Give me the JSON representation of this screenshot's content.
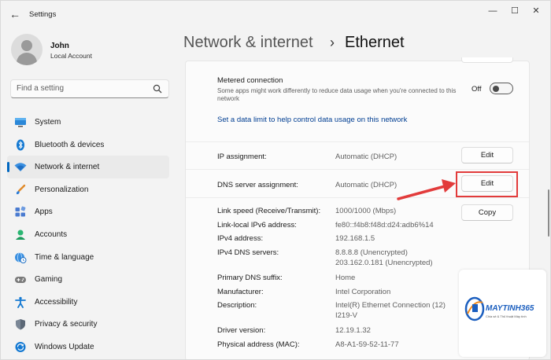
{
  "window": {
    "title": "Settings",
    "minimize": "—",
    "maximize": "☐",
    "close": "✕"
  },
  "profile": {
    "name": "John",
    "account": "Local Account"
  },
  "search": {
    "placeholder": "Find a setting"
  },
  "nav": {
    "items": [
      {
        "label": "System",
        "icon": "monitor-icon"
      },
      {
        "label": "Bluetooth & devices",
        "icon": "bluetooth-icon"
      },
      {
        "label": "Network & internet",
        "icon": "wifi-icon",
        "active": true
      },
      {
        "label": "Personalization",
        "icon": "brush-icon"
      },
      {
        "label": "Apps",
        "icon": "apps-icon"
      },
      {
        "label": "Accounts",
        "icon": "person-icon"
      },
      {
        "label": "Time & language",
        "icon": "globe-clock-icon"
      },
      {
        "label": "Gaming",
        "icon": "gamepad-icon"
      },
      {
        "label": "Accessibility",
        "icon": "accessibility-icon"
      },
      {
        "label": "Privacy & security",
        "icon": "shield-icon"
      },
      {
        "label": "Windows Update",
        "icon": "update-icon"
      }
    ]
  },
  "header": {
    "parent": "Network & internet",
    "separator": "›",
    "current": "Ethernet"
  },
  "metered": {
    "title": "Metered connection",
    "description": "Some apps might work differently to reduce data usage when you're connected to this network",
    "toggle_label": "Off",
    "toggle_on": false,
    "link": "Set a data limit to help control data usage on this network"
  },
  "ip": {
    "label": "IP assignment:",
    "value": "Automatic (DHCP)",
    "button": "Edit"
  },
  "dns": {
    "label": "DNS server assignment:",
    "value": "Automatic (DHCP)",
    "button": "Edit"
  },
  "copy_button": "Copy",
  "properties": [
    {
      "label": "Link speed (Receive/Transmit):",
      "value": "1000/1000 (Mbps)"
    },
    {
      "label": "Link-local IPv6 address:",
      "value": "fe80::f4b8:f48d:d24:adb6%14"
    },
    {
      "label": "IPv4 address:",
      "value": "192.168.1.5"
    },
    {
      "label": "IPv4 DNS servers:",
      "value": "8.8.8.8 (Unencrypted)",
      "value2": "203.162.0.181 (Unencrypted)"
    },
    {
      "label": "Primary DNS suffix:",
      "value": "Home"
    },
    {
      "label": "Manufacturer:",
      "value": "Intel Corporation"
    },
    {
      "label": "Description:",
      "value": "Intel(R) Ethernet Connection (12)",
      "value2": "I219-V"
    },
    {
      "label": "Driver version:",
      "value": "12.19.1.32"
    },
    {
      "label": "Physical address (MAC):",
      "value": "A8-A1-59-52-11-77"
    }
  ],
  "watermark": {
    "brand": "MAYTINH365",
    "tagline": "Chia sẻ & Thủ thuật Máy tính"
  },
  "colors": {
    "accent": "#0067c0",
    "highlight": "#e23b3b",
    "link": "#003e92"
  }
}
